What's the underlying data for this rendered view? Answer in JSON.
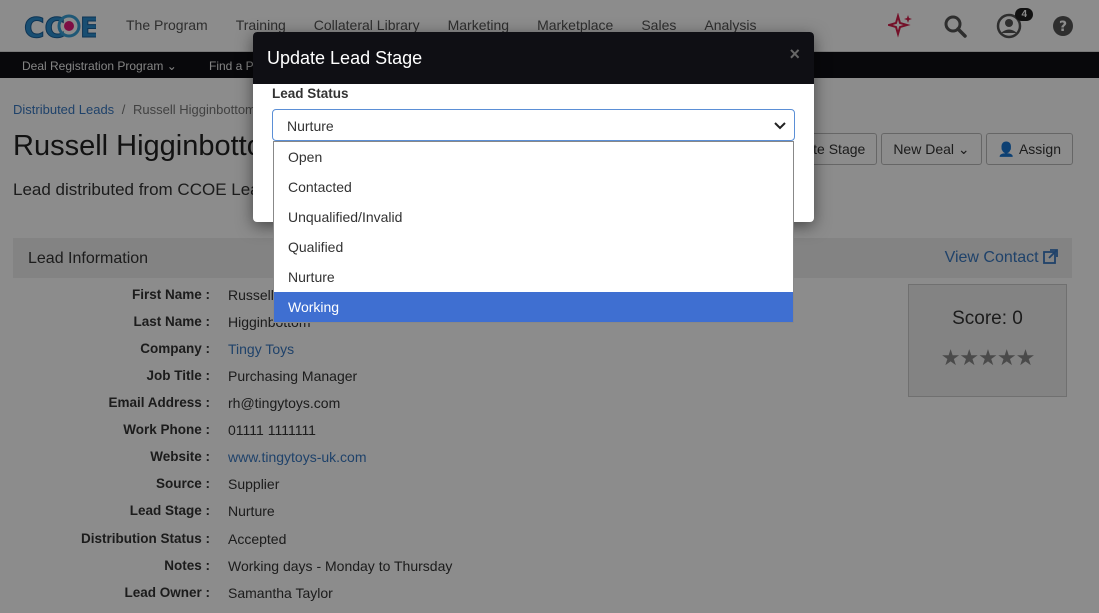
{
  "nav": {
    "logo_text": "CCOE",
    "items": [
      "The Program",
      "Training",
      "Collateral Library",
      "Marketing",
      "Marketplace",
      "Sales",
      "Analysis"
    ],
    "notification_count": "4"
  },
  "subnav": {
    "items": [
      "Deal Registration Program",
      "Find a P"
    ]
  },
  "breadcrumb": {
    "parent": "Distributed Leads",
    "separator": "/",
    "current": "Russell Higginbottom"
  },
  "page": {
    "title": "Russell Higginbottom",
    "subtitle": "Lead distributed from CCOE Lead Distribution"
  },
  "actions": {
    "update_stage": "Update Stage",
    "new_deal": "New Deal",
    "assign": "Assign"
  },
  "lead_info": {
    "header": "Lead Information",
    "view_contact": "View Contact",
    "fields": [
      {
        "label": "First Name :",
        "value": "Russell"
      },
      {
        "label": "Last Name :",
        "value": "Higginbottom"
      },
      {
        "label": "Company :",
        "value": "Tingy Toys"
      },
      {
        "label": "Job Title :",
        "value": "Purchasing Manager"
      },
      {
        "label": "Email Address :",
        "value": "rh@tingytoys.com"
      },
      {
        "label": "Work Phone :",
        "value": "01111 1111111"
      },
      {
        "label": "Website :",
        "value": "www.tingytoys-uk.com"
      },
      {
        "label": "Source :",
        "value": "Supplier"
      },
      {
        "label": "Lead Stage :",
        "value": "Nurture"
      },
      {
        "label": "Distribution Status :",
        "value": "Accepted"
      },
      {
        "label": "Notes :",
        "value": "Working days - Monday to Thursday"
      },
      {
        "label": "Lead Owner :",
        "value": "Samantha Taylor"
      }
    ]
  },
  "score": {
    "label": "Score: 0",
    "stars": "★★★★★",
    "rating": 0
  },
  "modal": {
    "title": "Update Lead Stage",
    "close": "×",
    "field_label": "Lead Status",
    "selected_value": "Nurture",
    "options": [
      "Open",
      "Contacted",
      "Unqualified/Invalid",
      "Qualified",
      "Nurture",
      "Working"
    ],
    "highlighted_option": "Working"
  },
  "colors": {
    "accent": "#3a79c2",
    "highlight": "#3f6fd1",
    "header_dark": "#0f0f14"
  }
}
